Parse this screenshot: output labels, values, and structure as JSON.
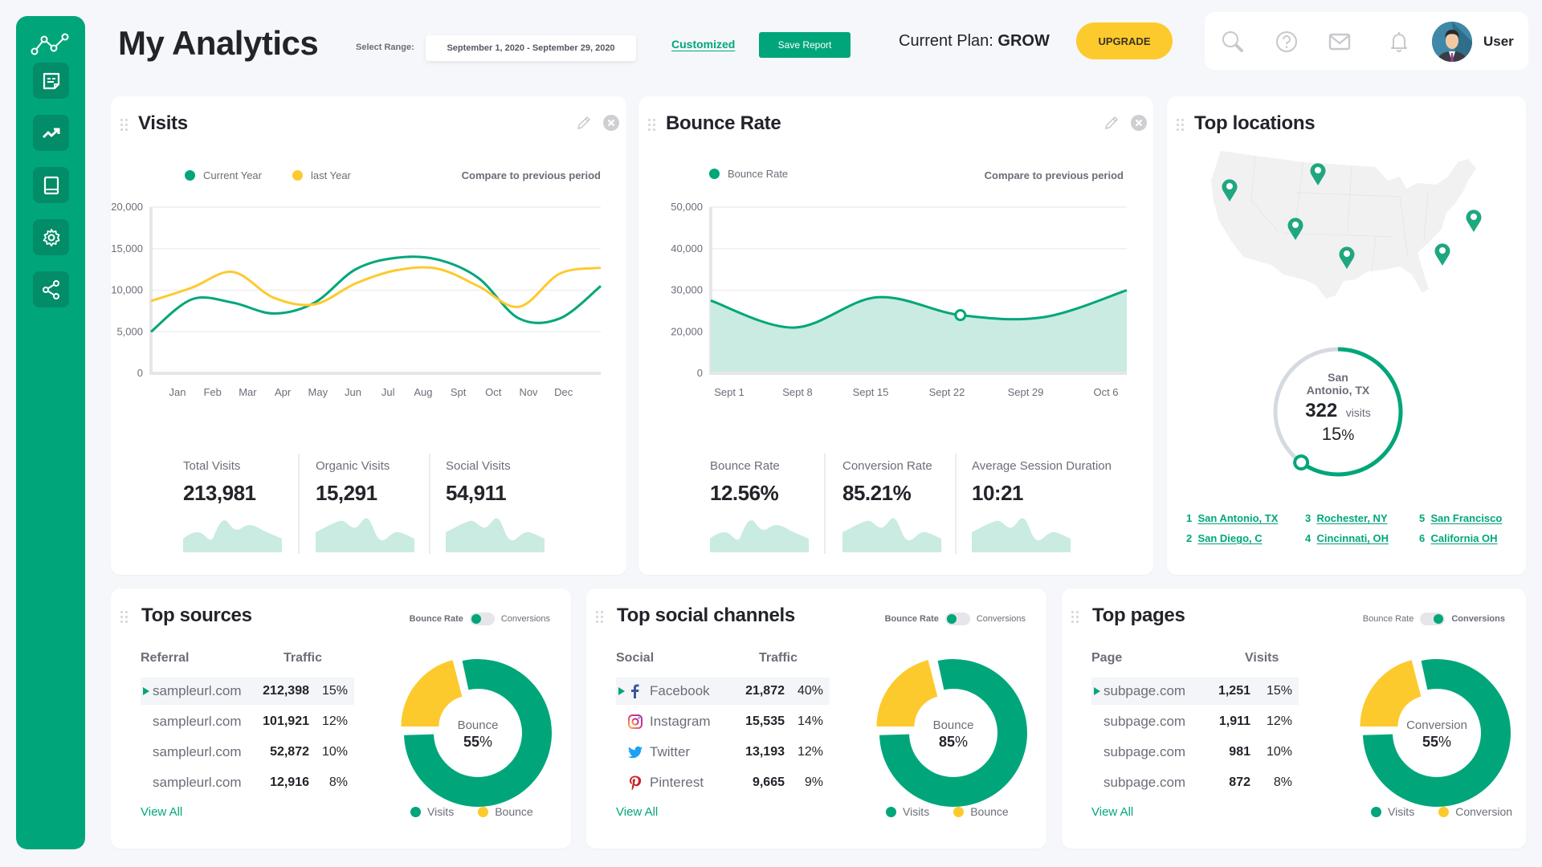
{
  "colors": {
    "accent": "#00a67a",
    "accent_dark": "#028c67",
    "yellow": "#fdca2e",
    "area_fill": "#c9ebe1",
    "text": "#22242a",
    "muted": "#6b6e78"
  },
  "sidebar": {
    "logo_icon": "line-chart-icon",
    "items": [
      {
        "icon": "note-icon",
        "label": "Notes"
      },
      {
        "icon": "trending-up-icon",
        "label": "Trends"
      },
      {
        "icon": "book-icon",
        "label": "Library"
      },
      {
        "icon": "gear-icon",
        "label": "Settings"
      },
      {
        "icon": "share-icon",
        "label": "Share"
      }
    ]
  },
  "header": {
    "title": "My Analytics",
    "range_label": "Select Range:",
    "range_value": "September 1, 2020 - September 29, 2020",
    "customized_label": "Customized",
    "save_report_label": "Save Report",
    "plan_prefix": "Current Plan:",
    "plan_name": "GROW",
    "upgrade_label": "UPGRADE",
    "toolbar_icons": [
      "search-icon",
      "help-icon",
      "mail-icon",
      "bell-icon"
    ],
    "user_name": "User"
  },
  "visits": {
    "title": "Visits",
    "legend": [
      "Current Year",
      "last Year"
    ],
    "compare_label": "Compare to previous period",
    "stats": [
      {
        "label": "Total Visits",
        "value": "213,981"
      },
      {
        "label": "Organic Visits",
        "value": "15,291"
      },
      {
        "label": "Social Visits",
        "value": "54,911"
      }
    ]
  },
  "bounce": {
    "title": "Bounce Rate",
    "legend": [
      "Bounce Rate"
    ],
    "compare_label": "Compare to previous period",
    "stats": [
      {
        "label": "Bounce Rate",
        "value": "12.56%"
      },
      {
        "label": "Conversion Rate",
        "value": "85.21%"
      },
      {
        "label": "Average Session Duration",
        "value": "10:21"
      }
    ]
  },
  "locations": {
    "title": "Top locations",
    "highlight": {
      "city_line1": "San",
      "city_line2": "Antonio, TX",
      "visits": "322",
      "visits_label": "visits",
      "percent": "15",
      "percent_sign": "%",
      "progress": 0.6
    },
    "list": [
      {
        "rank": "1",
        "name": "San Antonio, TX"
      },
      {
        "rank": "2",
        "name": "San Diego, C"
      },
      {
        "rank": "3",
        "name": "Rochester, NY"
      },
      {
        "rank": "4",
        "name": "Cincinnati, OH"
      },
      {
        "rank": "5",
        "name": "San Francisco"
      },
      {
        "rank": "6",
        "name": "California OH"
      }
    ]
  },
  "sources": {
    "title": "Top sources",
    "toggle": {
      "left": "Bounce Rate",
      "right": "Conversions",
      "active": "left"
    },
    "columns": [
      "Referral",
      "Traffic"
    ],
    "rows": [
      {
        "name": "sampleurl.com",
        "value": "212,398",
        "pct": "15%"
      },
      {
        "name": "sampleurl.com",
        "value": "101,921",
        "pct": "12%"
      },
      {
        "name": "sampleurl.com",
        "value": "52,872",
        "pct": "10%"
      },
      {
        "name": "sampleurl.com",
        "value": "12,916",
        "pct": "8%"
      }
    ],
    "view_all": "View All",
    "donut": {
      "label": "Bounce",
      "value": "55",
      "sign": "%",
      "yellow_fraction": 0.17
    },
    "legend": [
      "Visits",
      "Bounce"
    ]
  },
  "social": {
    "title": "Top social channels",
    "toggle": {
      "left": "Bounce Rate",
      "right": "Conversions",
      "active": "left"
    },
    "columns": [
      "Social",
      "Traffic"
    ],
    "rows": [
      {
        "icon": "facebook-icon",
        "name": "Facebook",
        "value": "21,872",
        "pct": "40%"
      },
      {
        "icon": "instagram-icon",
        "name": "Instagram",
        "value": "15,535",
        "pct": "14%"
      },
      {
        "icon": "twitter-icon",
        "name": "Twitter",
        "value": "13,193",
        "pct": "12%"
      },
      {
        "icon": "pinterest-icon",
        "name": "Pinterest",
        "value": "9,665",
        "pct": "9%"
      }
    ],
    "view_all": "View All",
    "donut": {
      "label": "Bounce",
      "value": "85",
      "sign": "%",
      "yellow_fraction": 0.17
    },
    "legend": [
      "Visits",
      "Bounce"
    ]
  },
  "pages": {
    "title": "Top pages",
    "toggle": {
      "left": "Bounce Rate",
      "right": "Conversions",
      "active": "right"
    },
    "columns": [
      "Page",
      "Visits"
    ],
    "rows": [
      {
        "name": "subpage.com",
        "value": "1,251",
        "pct": "15%"
      },
      {
        "name": "subpage.com",
        "value": "1,911",
        "pct": "12%"
      },
      {
        "name": "subpage.com",
        "value": "981",
        "pct": "10%"
      },
      {
        "name": "subpage.com",
        "value": "872",
        "pct": "8%"
      }
    ],
    "view_all": "View All",
    "donut": {
      "label": "Conversion",
      "value": "55",
      "sign": "%",
      "yellow_fraction": 0.17
    },
    "legend": [
      "Visits",
      "Conversion"
    ]
  },
  "chart_data": [
    {
      "type": "line",
      "title": "Visits",
      "categories": [
        "Jan",
        "Feb",
        "Mar",
        "Apr",
        "May",
        "Jun",
        "Jul",
        "Aug",
        "Spt",
        "Oct",
        "Nov",
        "Dec"
      ],
      "y_ticks": [
        "0",
        "5,000",
        "10,000",
        "15,000",
        "20,000"
      ],
      "ylim": [
        0,
        20000
      ],
      "grid": true,
      "legend_position": "top-left",
      "series": [
        {
          "name": "Current Year",
          "color": "#00a67a",
          "values": [
            5000,
            8900,
            8500,
            7200,
            8500,
            12500,
            13900,
            13700,
            11500,
            6600,
            6600,
            10500
          ]
        },
        {
          "name": "last Year",
          "color": "#fdca2e",
          "values": [
            8700,
            10300,
            12200,
            9100,
            8300,
            10800,
            12400,
            12600,
            10500,
            8000,
            12000,
            12700
          ]
        }
      ]
    },
    {
      "type": "area",
      "title": "Bounce Rate",
      "categories": [
        "Sept 1",
        "Sept 8",
        "Sept 15",
        "Sept 22",
        "Sept 29",
        "Oct 6"
      ],
      "y_ticks": [
        "0",
        "20,000",
        "30,000",
        "40,000",
        "50,000"
      ],
      "ylim": [
        0,
        50000
      ],
      "grid": true,
      "legend_position": "top-left",
      "series": [
        {
          "name": "Bounce Rate",
          "color": "#00a67a",
          "values": [
            27500,
            21000,
            28300,
            24000,
            23500,
            30000
          ]
        }
      ],
      "highlight_point": {
        "x": "Sept 22",
        "y": 24000
      }
    }
  ]
}
